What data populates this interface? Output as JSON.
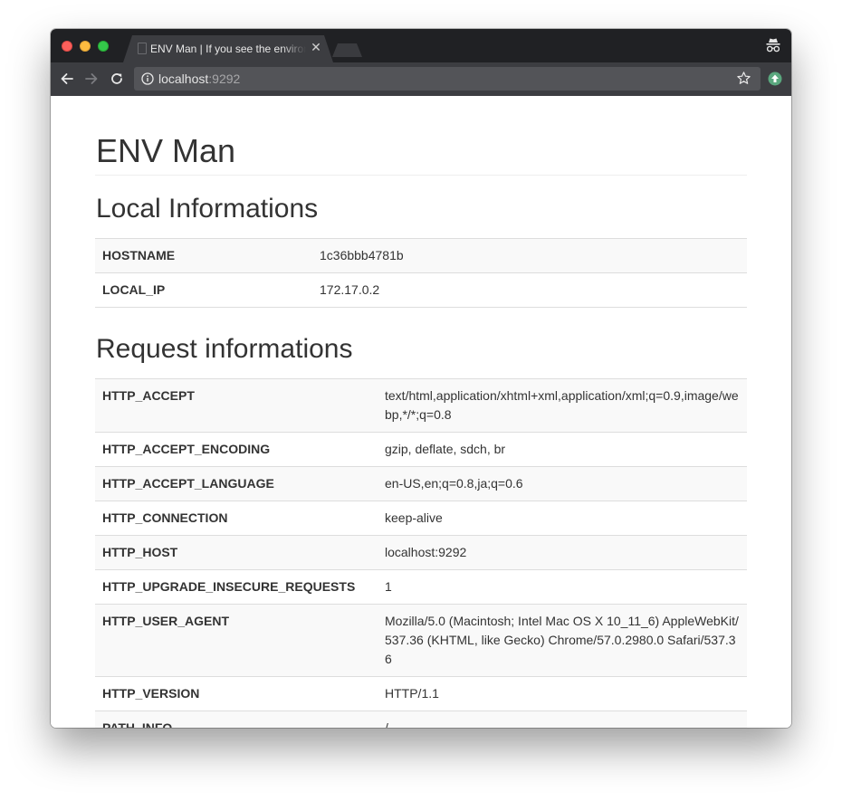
{
  "browser": {
    "tab_title": "ENV Man | If you see the environment",
    "tab_close_glyph": "✕",
    "url_host": "localhost",
    "url_port": ":9292",
    "icons": {
      "back": "back-arrow-icon",
      "forward": "forward-arrow-icon",
      "reload": "reload-icon",
      "info": "info-icon",
      "bookmark": "star-icon",
      "incognito": "incognito-icon",
      "extension": "update-arrow-icon"
    },
    "colors": {
      "tab_strip": "#202124",
      "toolbar": "#3c3d41",
      "omnibox": "#535458",
      "extension_green": "#5aa77e"
    }
  },
  "page": {
    "title": "ENV Man",
    "local_section": {
      "heading": "Local Informations",
      "rows": [
        {
          "key": "HOSTNAME",
          "value": "1c36bbb4781b"
        },
        {
          "key": "LOCAL_IP",
          "value": "172.17.0.2"
        }
      ]
    },
    "request_section": {
      "heading": "Request informations",
      "rows": [
        {
          "key": "HTTP_ACCEPT",
          "value": "text/html,application/xhtml+xml,application/xml;q=0.9,image/webp,*/*;q=0.8"
        },
        {
          "key": "HTTP_ACCEPT_ENCODING",
          "value": "gzip, deflate, sdch, br"
        },
        {
          "key": "HTTP_ACCEPT_LANGUAGE",
          "value": "en-US,en;q=0.8,ja;q=0.6"
        },
        {
          "key": "HTTP_CONNECTION",
          "value": "keep-alive"
        },
        {
          "key": "HTTP_HOST",
          "value": "localhost:9292"
        },
        {
          "key": "HTTP_UPGRADE_INSECURE_REQUESTS",
          "value": "1"
        },
        {
          "key": "HTTP_USER_AGENT",
          "value": "Mozilla/5.0 (Macintosh; Intel Mac OS X 10_11_6) AppleWebKit/537.36 (KHTML, like Gecko) Chrome/57.0.2980.0 Safari/537.36"
        },
        {
          "key": "HTTP_VERSION",
          "value": "HTTP/1.1"
        },
        {
          "key": "PATH_INFO",
          "value": "/"
        }
      ]
    }
  }
}
